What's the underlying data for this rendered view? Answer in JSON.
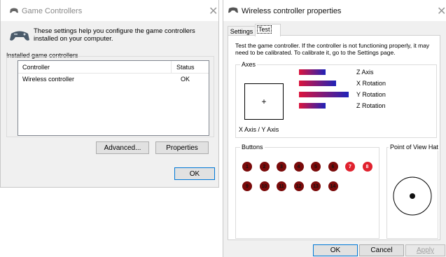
{
  "game_controllers": {
    "title": "Game Controllers",
    "description": "These settings help you configure the game controllers installed on your computer.",
    "group_label": "Installed game controllers",
    "columns": [
      "Controller",
      "Status"
    ],
    "rows": [
      {
        "controller": "Wireless controller",
        "status": "OK"
      }
    ],
    "advanced_label": "Advanced...",
    "properties_label": "Properties",
    "ok_label": "OK"
  },
  "properties": {
    "title": "Wireless controller properties",
    "tabs": [
      "Settings",
      "Test"
    ],
    "active_tab": "Test",
    "instructions": "Test the game controller.  If the controller is not functioning properly, it may need to be calibrated.  To calibrate it, go to the Settings page.",
    "axes_label": "Axes",
    "crosshair": "+",
    "xy_label": "X Axis / Y Axis",
    "axes": [
      {
        "name": "Z Axis",
        "value": 0.47
      },
      {
        "name": "X Rotation",
        "value": 0.66
      },
      {
        "name": "Y Rotation",
        "value": 0.89
      },
      {
        "name": "Z Rotation",
        "value": 0.47
      }
    ],
    "buttons_label": "Buttons",
    "buttons": [
      {
        "n": "1",
        "pressed": false
      },
      {
        "n": "2",
        "pressed": false
      },
      {
        "n": "3",
        "pressed": false
      },
      {
        "n": "4",
        "pressed": false
      },
      {
        "n": "5",
        "pressed": false
      },
      {
        "n": "6",
        "pressed": false
      },
      {
        "n": "7",
        "pressed": true
      },
      {
        "n": "8",
        "pressed": true
      },
      {
        "n": "9",
        "pressed": false
      },
      {
        "n": "10",
        "pressed": false
      },
      {
        "n": "11",
        "pressed": false
      },
      {
        "n": "12",
        "pressed": false
      },
      {
        "n": "13",
        "pressed": false
      },
      {
        "n": "14",
        "pressed": false
      }
    ],
    "pov_label": "Point of View Hat",
    "ok_label": "OK",
    "cancel_label": "Cancel",
    "apply_label": "Apply"
  },
  "colors": {
    "bar_start": "#dc143c",
    "bar_end": "#1e22b8",
    "button_idle": "#7a0a0a",
    "button_pressed": "#e0222e",
    "focus_border": "#0078d7"
  }
}
